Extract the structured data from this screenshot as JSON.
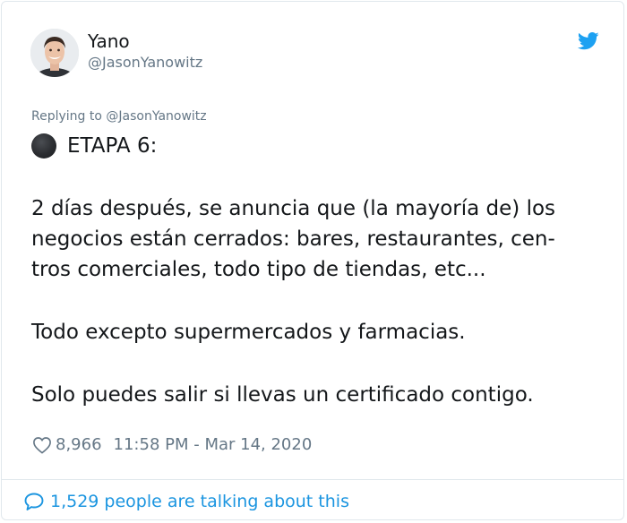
{
  "author": {
    "display_name": "Yano",
    "handle": "@JasonYanowitz",
    "avatar": "profile-photo"
  },
  "reply_context": "Replying to @JasonYanowitz",
  "tweet": {
    "stage_icon": "black-circle-emoji",
    "stage_title": "ETAPA 6:",
    "lines": [
      "2 días después, se anuncia que (la mayoría de) los",
      "negocios están cerrados: bares, restaurantes, cen-",
      "tros comerciales, todo tipo de tiendas, etc...",
      "Todo excepto supermercados y farmacias.",
      "Solo puedes salir si llevas un certificado contigo."
    ]
  },
  "meta": {
    "likes": "8,966",
    "timestamp": "11:58 PM - Mar 14, 2020"
  },
  "footer": {
    "talking": "1,529 people are talking about this"
  },
  "colors": {
    "twitter_blue": "#1da1f2",
    "link_blue": "#1b95e0",
    "secondary_text": "#657786",
    "border": "#e1e8ed"
  },
  "icons": [
    "twitter-bird-icon",
    "heart-icon",
    "speech-bubble-icon",
    "black-circle-emoji"
  ]
}
